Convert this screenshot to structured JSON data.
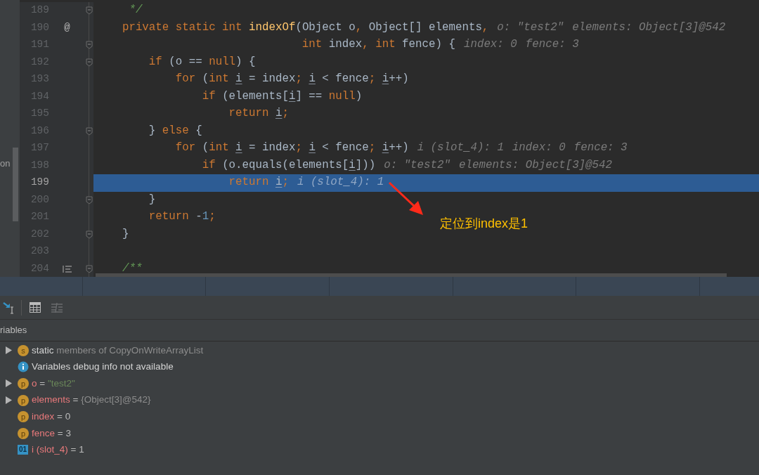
{
  "editor": {
    "side_label": "on",
    "lines": [
      {
        "number": "189",
        "fold": true,
        "current": false,
        "tokens": [
          {
            "t": "     */",
            "kind": "comment"
          }
        ]
      },
      {
        "number": "190",
        "fold": false,
        "current": false,
        "gutter_mark": "@",
        "tokens": [
          {
            "t": "    private static int ",
            "kind": "kw"
          },
          {
            "t": "indexOf",
            "kind": "fn"
          },
          {
            "t": "(Object o",
            "kind": "plain"
          },
          {
            "t": ", ",
            "kind": "kw"
          },
          {
            "t": "Object[] elements",
            "kind": "plain"
          },
          {
            "t": ",",
            "kind": "kw"
          }
        ],
        "hints": [
          "o: \"test2\"",
          "elements: Object[3]@542"
        ]
      },
      {
        "number": "191",
        "fold": true,
        "current": false,
        "tokens": [
          {
            "t": "                               int ",
            "kind": "kw"
          },
          {
            "t": "index",
            "kind": "plain"
          },
          {
            "t": ", ",
            "kind": "kw"
          },
          {
            "t": "int ",
            "kind": "kw"
          },
          {
            "t": "fence) {",
            "kind": "plain"
          }
        ],
        "hints": [
          "index: 0",
          "fence: 3"
        ]
      },
      {
        "number": "192",
        "fold": true,
        "current": false,
        "tokens": [
          {
            "t": "        if ",
            "kind": "kw"
          },
          {
            "t": "(o == ",
            "kind": "plain"
          },
          {
            "t": "null",
            "kind": "kw"
          },
          {
            "t": ") {",
            "kind": "plain"
          }
        ]
      },
      {
        "number": "193",
        "fold": false,
        "current": false,
        "tokens": [
          {
            "t": "            for ",
            "kind": "kw"
          },
          {
            "t": "(",
            "kind": "plain"
          },
          {
            "t": "int ",
            "kind": "kw"
          },
          {
            "t": "i",
            "kind": "var"
          },
          {
            "t": " = index",
            "kind": "plain"
          },
          {
            "t": "; ",
            "kind": "kw"
          },
          {
            "t": "i",
            "kind": "var"
          },
          {
            "t": " < fence",
            "kind": "plain"
          },
          {
            "t": "; ",
            "kind": "kw"
          },
          {
            "t": "i",
            "kind": "var"
          },
          {
            "t": "++)",
            "kind": "plain"
          }
        ]
      },
      {
        "number": "194",
        "fold": false,
        "current": false,
        "tokens": [
          {
            "t": "                if ",
            "kind": "kw"
          },
          {
            "t": "(elements[",
            "kind": "plain"
          },
          {
            "t": "i",
            "kind": "var"
          },
          {
            "t": "] == ",
            "kind": "plain"
          },
          {
            "t": "null",
            "kind": "kw"
          },
          {
            "t": ")",
            "kind": "plain"
          }
        ]
      },
      {
        "number": "195",
        "fold": false,
        "current": false,
        "tokens": [
          {
            "t": "                    return ",
            "kind": "kw"
          },
          {
            "t": "i",
            "kind": "var"
          },
          {
            "t": ";",
            "kind": "kw"
          }
        ]
      },
      {
        "number": "196",
        "fold": true,
        "current": false,
        "tokens": [
          {
            "t": "        } ",
            "kind": "plain"
          },
          {
            "t": "else ",
            "kind": "kw"
          },
          {
            "t": "{",
            "kind": "plain"
          }
        ]
      },
      {
        "number": "197",
        "fold": false,
        "current": false,
        "tokens": [
          {
            "t": "            for ",
            "kind": "kw"
          },
          {
            "t": "(",
            "kind": "plain"
          },
          {
            "t": "int ",
            "kind": "kw"
          },
          {
            "t": "i",
            "kind": "var"
          },
          {
            "t": " = index",
            "kind": "plain"
          },
          {
            "t": "; ",
            "kind": "kw"
          },
          {
            "t": "i",
            "kind": "var"
          },
          {
            "t": " < fence",
            "kind": "plain"
          },
          {
            "t": "; ",
            "kind": "kw"
          },
          {
            "t": "i",
            "kind": "var"
          },
          {
            "t": "++)",
            "kind": "plain"
          }
        ],
        "hints": [
          "i (slot_4): 1",
          "index: 0",
          "fence: 3"
        ]
      },
      {
        "number": "198",
        "fold": false,
        "current": false,
        "tokens": [
          {
            "t": "                if ",
            "kind": "kw"
          },
          {
            "t": "(o.equals(elements[",
            "kind": "plain"
          },
          {
            "t": "i",
            "kind": "var"
          },
          {
            "t": "]))",
            "kind": "plain"
          }
        ],
        "hints": [
          "o: \"test2\"",
          "elements: Object[3]@542"
        ]
      },
      {
        "number": "199",
        "fold": false,
        "current": true,
        "tokens": [
          {
            "t": "                    return ",
            "kind": "kw"
          },
          {
            "t": "i",
            "kind": "var"
          },
          {
            "t": ";",
            "kind": "kw"
          }
        ],
        "hints": [
          "i (slot_4): 1"
        ]
      },
      {
        "number": "200",
        "fold": true,
        "current": false,
        "tokens": [
          {
            "t": "        }",
            "kind": "plain"
          }
        ]
      },
      {
        "number": "201",
        "fold": false,
        "current": false,
        "tokens": [
          {
            "t": "        return ",
            "kind": "kw"
          },
          {
            "t": "-",
            "kind": "plain"
          },
          {
            "t": "1",
            "kind": "num"
          },
          {
            "t": ";",
            "kind": "kw"
          }
        ]
      },
      {
        "number": "202",
        "fold": true,
        "current": false,
        "tokens": [
          {
            "t": "    }",
            "kind": "plain"
          }
        ]
      },
      {
        "number": "203",
        "fold": false,
        "current": false
      },
      {
        "number": "204",
        "fold": true,
        "current": false,
        "gutter_icon": {
          "kind": "doc"
        },
        "tokens": [
          {
            "t": "    /**",
            "kind": "comment"
          }
        ]
      }
    ]
  },
  "annotation": {
    "text": "定位到index是1"
  },
  "variables": {
    "title": "riables",
    "rows": [
      {
        "kind": "static",
        "expandable": true,
        "badge": "s",
        "name": "static",
        "value": "members of CopyOnWriteArrayList"
      },
      {
        "kind": "info",
        "expandable": false,
        "name": "Variables debug info not available"
      },
      {
        "kind": "param",
        "expandable": true,
        "badge": "p",
        "name": "o",
        "operator": "=",
        "value": {
          "text": "\"test2\"",
          "kind": "string"
        }
      },
      {
        "kind": "param",
        "expandable": true,
        "badge": "p",
        "name": "elements",
        "operator": "=",
        "value": {
          "text": "{Object[3]@542}",
          "kind": "object"
        }
      },
      {
        "kind": "param",
        "expandable": false,
        "badge": "p",
        "name": "index",
        "operator": "=",
        "value": {
          "text": "0",
          "kind": "number"
        }
      },
      {
        "kind": "param",
        "expandable": false,
        "badge": "p",
        "name": "fence",
        "operator": "=",
        "value": {
          "text": "3",
          "kind": "number"
        }
      },
      {
        "kind": "local",
        "expandable": false,
        "badge": "01",
        "name": "i (slot_4)",
        "operator": "=",
        "value": {
          "text": "1",
          "kind": "number"
        }
      }
    ]
  }
}
